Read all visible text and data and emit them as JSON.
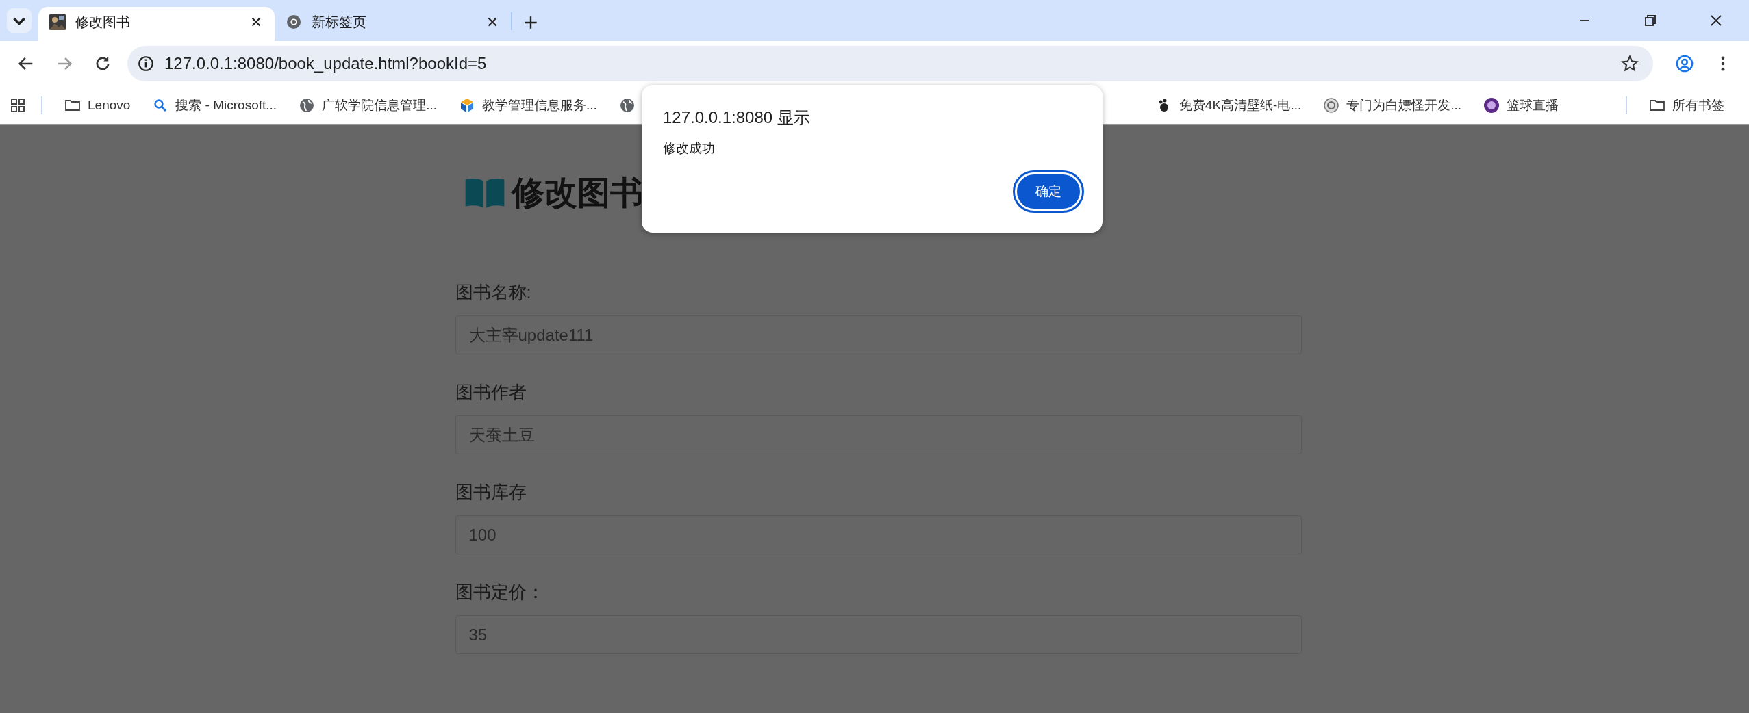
{
  "tabs": [
    {
      "title": "修改图书",
      "selected": true
    },
    {
      "title": "新标签页",
      "selected": false,
      "kind": "chrome"
    }
  ],
  "address": "127.0.0.1:8080/book_update.html?bookId=5",
  "bookmarks": [
    {
      "label": "Lenovo",
      "kind": "folder"
    },
    {
      "label": "搜索 - Microsoft...",
      "kind": "search"
    },
    {
      "label": "广软学院信息管理...",
      "kind": "globe"
    },
    {
      "label": "教学管理信息服务...",
      "kind": "logo"
    },
    {
      "kind": "globe"
    },
    {
      "label": "免费4K高清壁纸-电...",
      "kind": "paw"
    },
    {
      "label": "专门为白嫖怪开发...",
      "kind": "flower"
    },
    {
      "label": "篮球直播",
      "kind": "emblem"
    }
  ],
  "all_bookmarks": "所有书签",
  "dialog": {
    "title": "127.0.0.1:8080 显示",
    "message": "修改成功",
    "button": "确定"
  },
  "page": {
    "heading": "修改图书",
    "fields": [
      {
        "label": "图书名称:",
        "value": "大主宰update111"
      },
      {
        "label": "图书作者",
        "value": "天蚕土豆"
      },
      {
        "label": "图书库存",
        "value": "100"
      },
      {
        "label": "图书定价：",
        "value": "35"
      }
    ]
  }
}
